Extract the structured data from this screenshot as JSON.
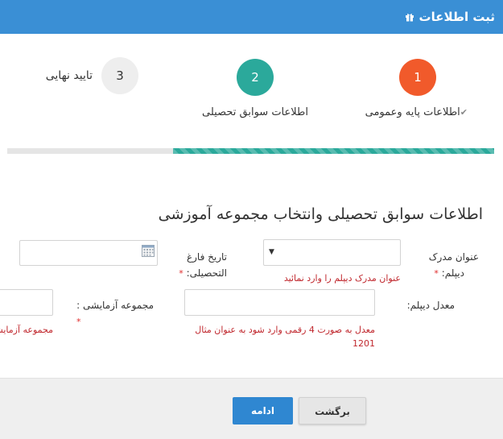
{
  "header": {
    "title": "ثبت اطلاعات",
    "icon": "gift-icon"
  },
  "colors": {
    "header": "#3a8fd5",
    "step_active": "#f15a2b",
    "step_done": "#2ba99b",
    "step_pending": "#eeeeee",
    "error": "#c0272d",
    "primary_button": "#2f87d1"
  },
  "steps": [
    {
      "number": "1",
      "label": "اطلاعات پایه وعمومی",
      "check": "✔",
      "state": "active"
    },
    {
      "number": "2",
      "label": "اطلاعات سوابق تحصیلی",
      "state": "current"
    },
    {
      "number": "3",
      "label": "تایید نهایی",
      "state": "pending"
    }
  ],
  "progress": {
    "fraction": 0.66
  },
  "form": {
    "section_title": "اطلاعات سوابق تحصیلی وانتخاب مجموعه آموزشی",
    "diploma_title": {
      "label_line1": "عنوان مدرک",
      "label_line2": "دیپلم:",
      "required": "*",
      "value": "",
      "error": "عنوان مدرک دیپلم را وارد نمائید"
    },
    "graduation_date": {
      "label_line1": "تاریخ فارغ",
      "label_line2": "التحصیلی:",
      "required": "*",
      "value": ""
    },
    "diploma_gpa": {
      "label": "معدل دیپلم:",
      "value": "",
      "error_line1": "معدل به صورت 4 رقمی وارد شود به عنوان مثال",
      "error_line2": "1201"
    },
    "test_group": {
      "label": "مجموعه آزمایشی :",
      "required": "*",
      "value": "",
      "error": "مجموعه آزمایشی"
    }
  },
  "footer": {
    "back_label": "برگشت",
    "continue_label": "ادامه"
  }
}
